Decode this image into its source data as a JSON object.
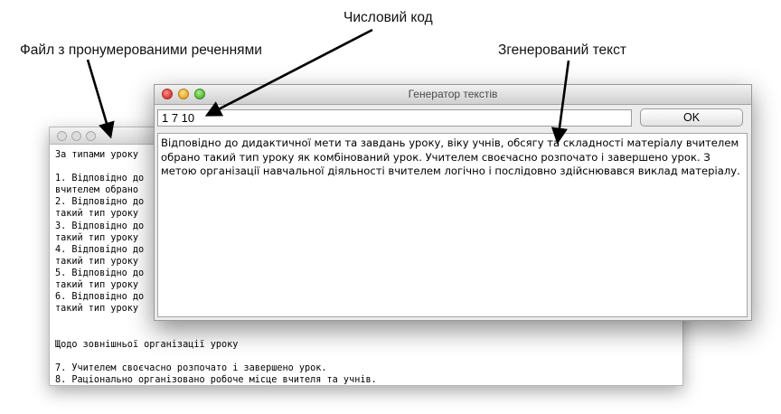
{
  "annotations": {
    "file_label": "Файл з пронумерованими реченнями",
    "code_label": "Числовий код",
    "generated_label": "Згенерований текст"
  },
  "background_window": {
    "lines": [
      "За типами уроку",
      "",
      "1. Відповідно до",
      "вчителем обрано",
      "2. Відповідно до",
      "такий тип уроку",
      "3. Відповідно до",
      "такий тип уроку",
      "4. Відповідно до",
      "такий тип уроку",
      "5. Відповідно до",
      "такий тип уроку",
      "6. Відповідно до",
      "такий тип уроку",
      "",
      "",
      "Щодо зовнішньої організації уроку",
      "",
      "7. Учителем своєчасно розпочато і завершено урок.",
      "8. Раціонально організовано робоче місце вчителя та учнів."
    ]
  },
  "generator_window": {
    "title": "Генератор текстів",
    "code_value": "1 7 10",
    "ok_label": "OK",
    "output_text": "Відповідно до дидактичної мети та завдань уроку, віку учнів, обсягу та складності матеріалу вчителем обрано такий тип уроку як комбінований урок. Учителем своєчасно розпочато і завершено урок. З метою організації навчальної діяльності вчителем логічно і послідовно здійснювався виклад матеріалу."
  },
  "colors": {
    "close": "#e0443b",
    "minimize": "#f0b22b",
    "maximize": "#5fc23c"
  }
}
